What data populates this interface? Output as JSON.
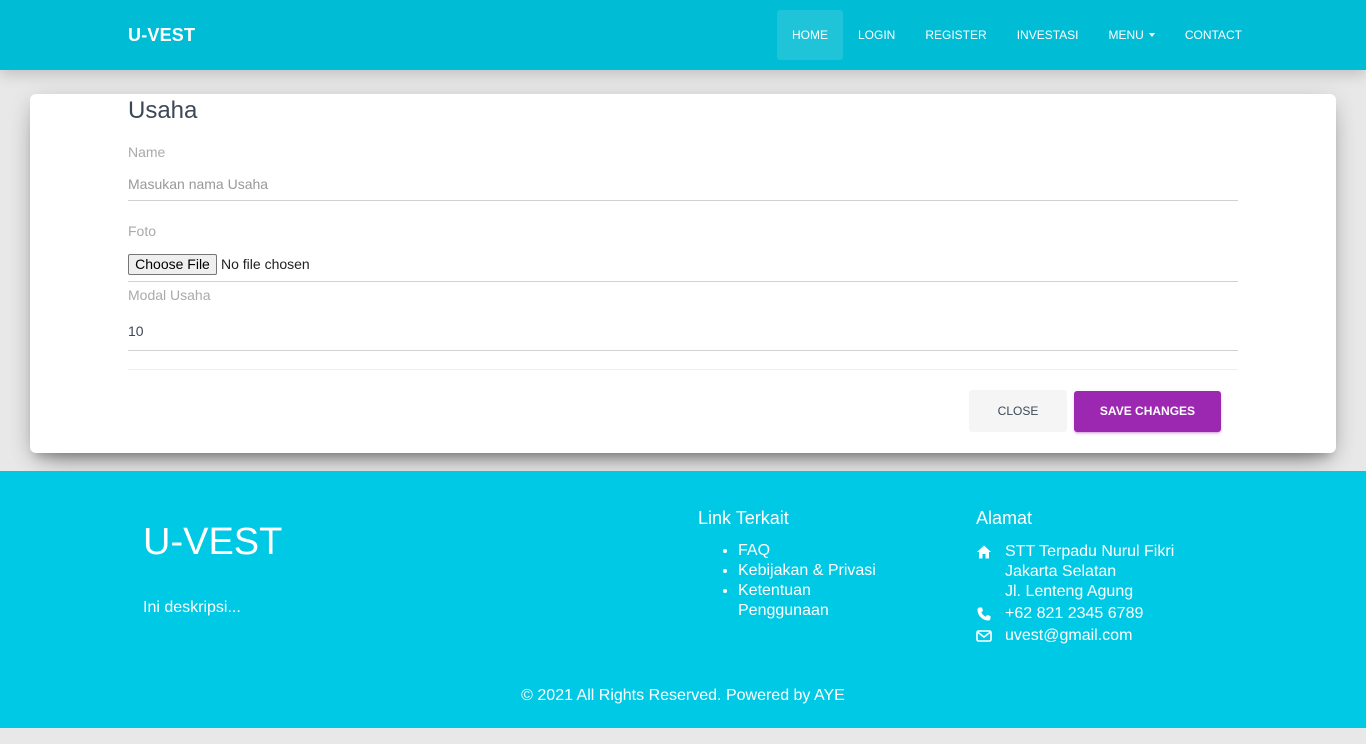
{
  "navbar": {
    "brand": "U-VEST",
    "links": [
      {
        "label": "HOME",
        "active": true
      },
      {
        "label": "LOGIN"
      },
      {
        "label": "REGISTER"
      },
      {
        "label": "INVESTASI"
      },
      {
        "label": "MENU",
        "dropdown": true
      },
      {
        "label": "CONTACT"
      }
    ],
    "bg_color": "#00bcd4"
  },
  "form": {
    "title": "Usaha",
    "name_label": "Name",
    "name_placeholder": "Masukan nama Usaha",
    "foto_label": "Foto",
    "file_button": "Choose File",
    "file_status": "No file chosen",
    "modal_label": "Modal Usaha",
    "modal_value": "10",
    "close_label": "CLOSE",
    "save_label": "SAVE CHANGES",
    "save_color": "#9c27b0"
  },
  "footer": {
    "brand": "U-VEST",
    "description": "Ini deskripsi...",
    "links_heading": "Link Terkait",
    "links": [
      "FAQ",
      "Kebijakan & Privasi",
      "Ketentuan Penggunaan"
    ],
    "address_heading": "Alamat",
    "address_lines": [
      "STT Terpadu Nurul Fikri",
      "Jakarta Selatan",
      "Jl. Lenteng Agung"
    ],
    "phone": "+62 821 2345 6789",
    "email": "uvest@gmail.com",
    "copyright": "© 2021 All Rights Reserved. Powered by AYE",
    "bg_color": "#00c9e5",
    "icons": [
      "home-icon",
      "phone-icon",
      "envelope-icon"
    ]
  }
}
